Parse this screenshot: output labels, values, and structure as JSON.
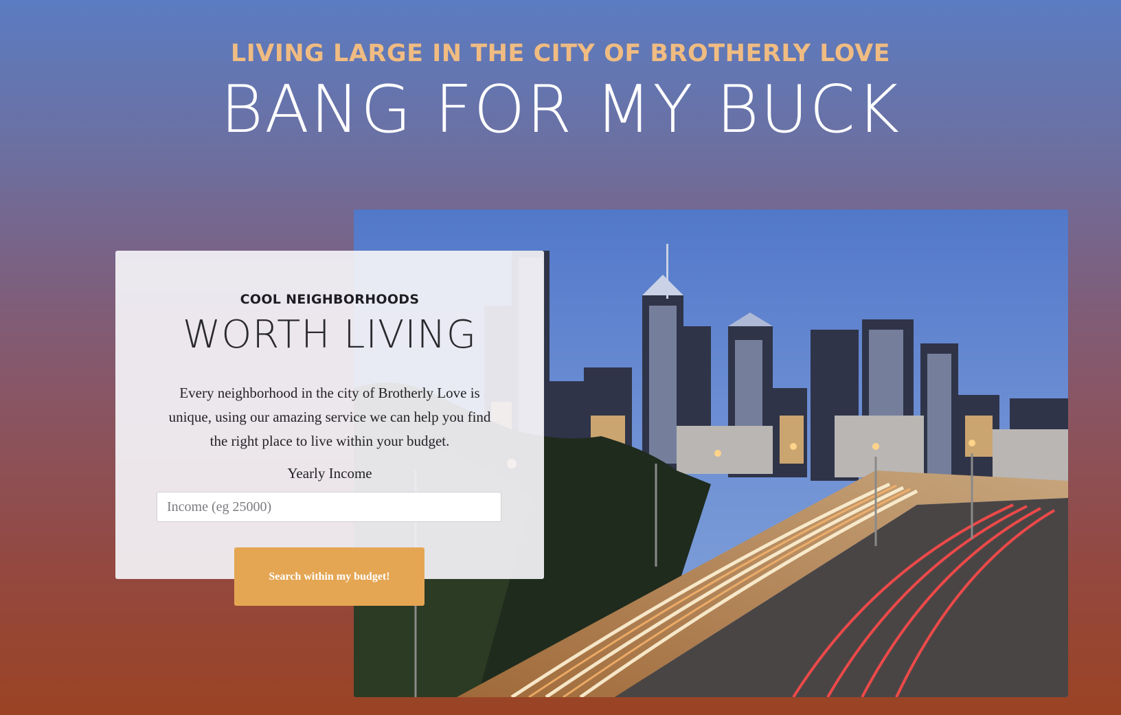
{
  "hero": {
    "eyebrow": "LIVING LARGE IN THE CITY OF BROTHERLY LOVE",
    "headline": "BANG FOR MY BUCK"
  },
  "card": {
    "eyebrow": "COOL NEIGHBORHOODS",
    "title": "WORTH LIVING",
    "description": "Every neighborhood in the city of Brotherly Love is unique, using our amazing service we can help you find the right place to live within your budget.",
    "income_label": "Yearly Income",
    "income_placeholder": "Income (eg 25000)",
    "income_value": ""
  },
  "search_button": {
    "label": "Search within my budget!"
  },
  "colors": {
    "eyebrow": "#f0bc82",
    "button": "#e4a653"
  }
}
